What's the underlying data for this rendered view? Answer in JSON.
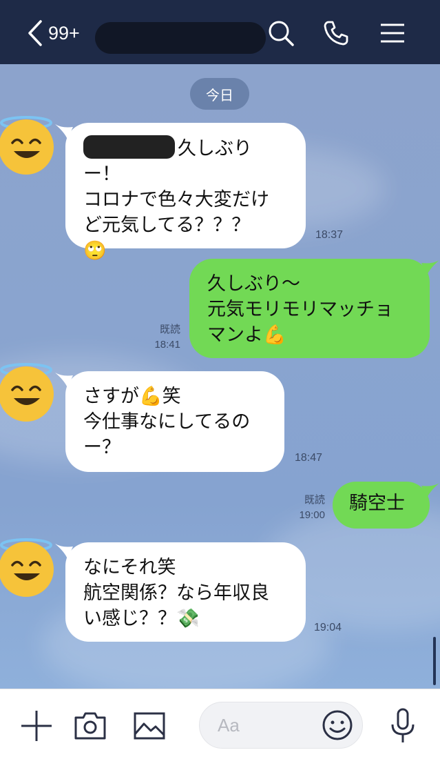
{
  "header": {
    "unread_count": "99+",
    "icons": [
      "back-chevron-icon",
      "search-icon",
      "phone-icon",
      "menu-icon"
    ]
  },
  "chat": {
    "date_label": "今日",
    "messages": [
      {
        "side": "in",
        "lines": [
          "久しぶりー！",
          "コロナで色々大変だけ",
          "ど元気してる？？？"
        ],
        "emoji": "🙄",
        "time": "18:37"
      },
      {
        "side": "out",
        "lines": [
          "久しぶり〜",
          "元気モリモリマッチョ",
          "マンよ"
        ],
        "emoji": "💪",
        "read": "既読",
        "time": "18:41"
      },
      {
        "side": "in",
        "lines": [
          "さすが",
          "今仕事なにしてるの",
          "ー？"
        ],
        "emoji": "💪",
        "emoji_trail": "笑",
        "time": "18:47"
      },
      {
        "side": "out",
        "lines": [
          "騎空士"
        ],
        "read": "既読",
        "time": "19:00"
      },
      {
        "side": "in",
        "lines": [
          "なにそれ笑",
          "航空関係？なら年収良",
          "い感じ？？"
        ],
        "emoji": "💸",
        "time": "19:04"
      }
    ]
  },
  "composer": {
    "placeholder": "Aa",
    "icons": [
      "plus-icon",
      "camera-icon",
      "image-icon",
      "emoji-icon",
      "microphone-icon"
    ]
  },
  "colors": {
    "header_bg": "#1e2a47",
    "incoming_bubble": "#ffffff",
    "outgoing_bubble": "#72d955",
    "chat_bg": "#8aa3cc"
  }
}
